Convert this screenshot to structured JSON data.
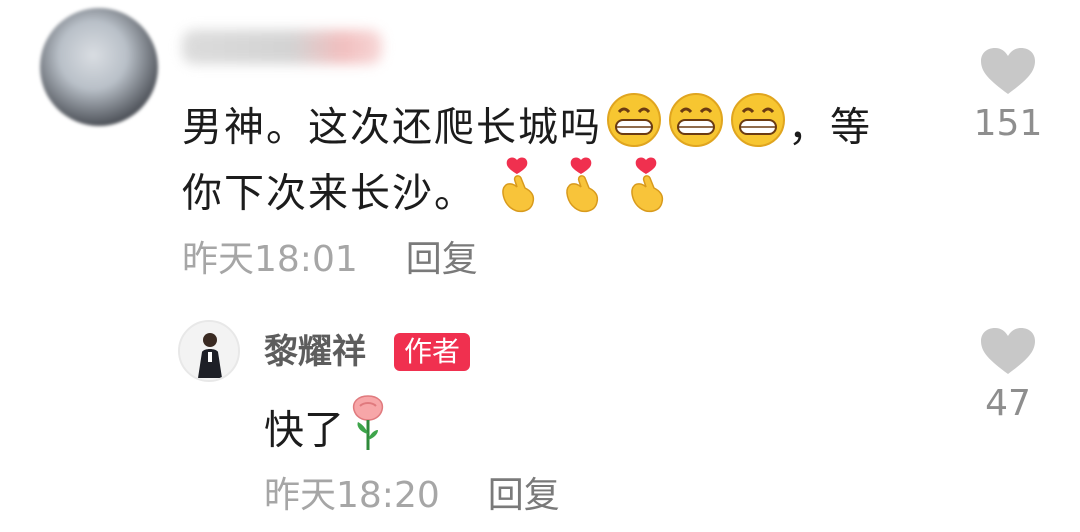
{
  "comment": {
    "username": "",
    "line1": "男神。这次还爬长城吗",
    "line1_suffix": "，等",
    "line2": "你下次来长沙。",
    "time": "昨天18:01",
    "reply_label": "回复",
    "like_count": "151",
    "emoji_grin_count": 3,
    "emoji_finger_heart_count": 3
  },
  "reply": {
    "username": "黎耀祥",
    "badge": "作者",
    "text": "快了",
    "time": "昨天18:20",
    "reply_label": "回复",
    "like_count": "47"
  },
  "colors": {
    "badge": "#f0304f",
    "meta": "#a6a6a6",
    "heart": "#c8c8c8"
  },
  "icons": {
    "like": "heart-icon",
    "grin": "grinning-face-icon",
    "finger_heart": "finger-heart-icon",
    "rose": "rose-icon"
  }
}
